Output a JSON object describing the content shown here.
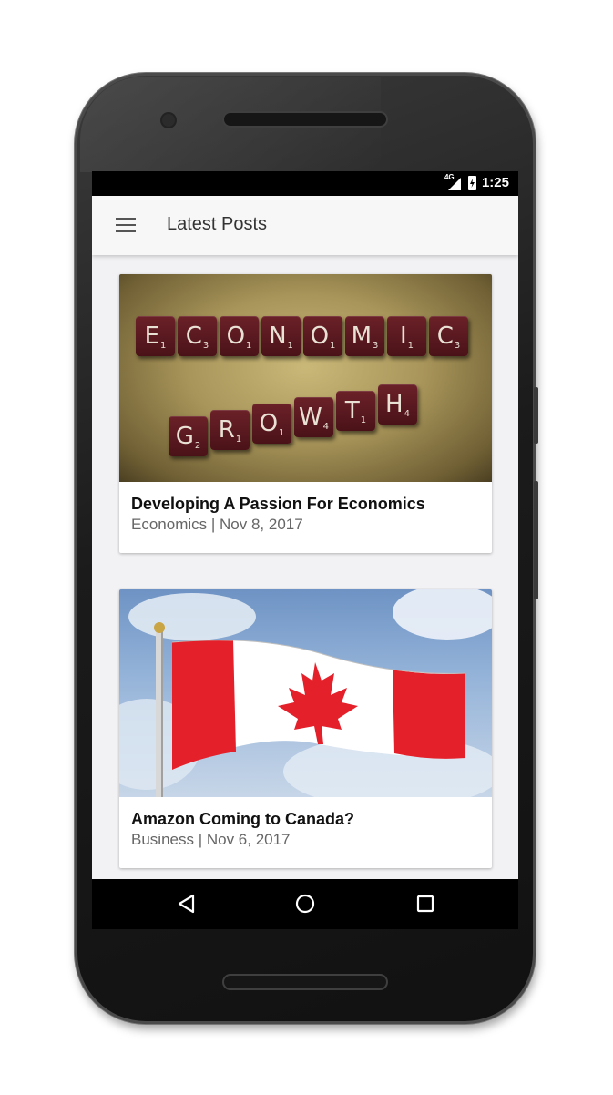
{
  "status_bar": {
    "network": "4G",
    "time": "1:25"
  },
  "app_bar": {
    "title": "Latest Posts",
    "menu_icon": "hamburger-menu-icon"
  },
  "posts": [
    {
      "title": "Developing A Passion For Economics",
      "category": "Economics",
      "date": "Nov 8, 2017",
      "meta": "Economics | Nov 8, 2017",
      "image": "Scrabble tiles spelling ECONOMIC GROWTH",
      "tiles_row1": [
        "E",
        "C",
        "O",
        "N",
        "O",
        "M",
        "I",
        "C"
      ],
      "tiles_row1_scores": [
        "1",
        "3",
        "1",
        "1",
        "1",
        "3",
        "1",
        "3"
      ],
      "tiles_row2": [
        "G",
        "R",
        "O",
        "W",
        "T",
        "H"
      ],
      "tiles_row2_scores": [
        "2",
        "1",
        "1",
        "4",
        "1",
        "4"
      ]
    },
    {
      "title": "Amazon Coming to Canada?",
      "category": "Business",
      "date": "Nov 6, 2017",
      "meta": "Business | Nov 6, 2017",
      "image": "Canadian flag waving against sky"
    }
  ],
  "nav_bar": {
    "back_icon": "back-triangle-icon",
    "home_icon": "home-circle-icon",
    "recents_icon": "recents-square-icon"
  },
  "colors": {
    "flag_red": "#e4202a",
    "tile": "#5a1a20"
  }
}
